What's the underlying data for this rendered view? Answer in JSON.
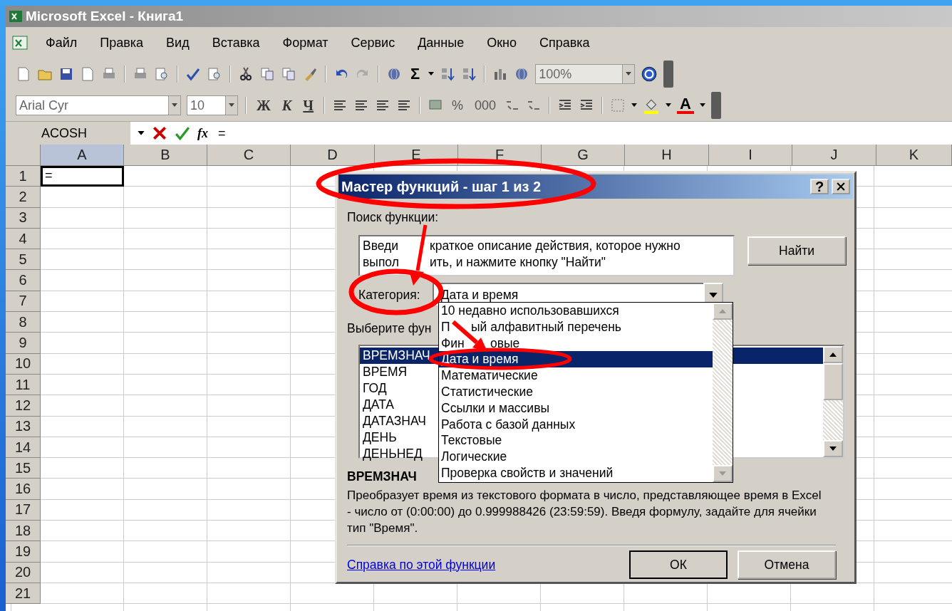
{
  "window": {
    "title": "Microsoft Excel - Книга1"
  },
  "menu": [
    "Файл",
    "Правка",
    "Вид",
    "Вставка",
    "Формат",
    "Сервис",
    "Данные",
    "Окно",
    "Справка"
  ],
  "standard_toolbar": {
    "sum": "Σ",
    "zoom": "100%"
  },
  "formatting_toolbar": {
    "font": "Arial Cyr",
    "size": "10",
    "styles": [
      "Ж",
      "К",
      "Ч"
    ],
    "percent": "%",
    "thousands": "000",
    "font_color": "A"
  },
  "formula_bar": {
    "name_box": "ACOSH",
    "fx": "fx",
    "value": "="
  },
  "sheet": {
    "columns": [
      "A",
      "B",
      "C",
      "D",
      "E",
      "F",
      "G",
      "H",
      "I",
      "J",
      "K"
    ],
    "rows": [
      "1",
      "2",
      "3",
      "4",
      "5",
      "6",
      "7",
      "8",
      "9",
      "10",
      "11",
      "12",
      "13",
      "14",
      "15",
      "16",
      "17",
      "18",
      "19",
      "20",
      "21"
    ],
    "active_cell": {
      "value": "=",
      "selected": true
    }
  },
  "dialog": {
    "title": "Мастер функций - шаг 1 из 2",
    "help": "?",
    "search_label": "Поиск функции:",
    "search_lines": [
      [
        "Введи",
        "краткое описание действия, которое нужно"
      ],
      [
        "выпол",
        "ить, и нажмите кнопку \"Найти\""
      ]
    ],
    "find_button": "Найти",
    "category_label": "Категория:",
    "category_value": "Дата и время",
    "select_label": "Выберите фун",
    "functions": [
      {
        "name": "ВРЕМЗНАЧ",
        "selected": true
      },
      {
        "name": "ВРЕМЯ",
        "selected": false
      },
      {
        "name": "ГОД",
        "selected": false
      },
      {
        "name": "ДАТА",
        "selected": false
      },
      {
        "name": "ДАТАЗНАЧ",
        "selected": false
      },
      {
        "name": "ДЕНЬ",
        "selected": false
      },
      {
        "name": "ДЕНЬНЕД",
        "selected": false
      }
    ],
    "category_options": [
      {
        "label": [
          "10 недавно использовавшихся"
        ],
        "selected": false
      },
      {
        "label": [
          "П",
          "ый алфавитный перечень"
        ],
        "selected": false
      },
      {
        "label": [
          "Фин",
          "овые"
        ],
        "selected": false
      },
      {
        "label": [
          "Дата и время"
        ],
        "selected": true
      },
      {
        "label": [
          "Математические"
        ],
        "selected": false
      },
      {
        "label": [
          "Статистические"
        ],
        "selected": false
      },
      {
        "label": [
          "Ссылки и массивы"
        ],
        "selected": false
      },
      {
        "label": [
          "Работа с базой данных"
        ],
        "selected": false
      },
      {
        "label": [
          "Текстовые"
        ],
        "selected": false
      },
      {
        "label": [
          "Логические"
        ],
        "selected": false
      },
      {
        "label": [
          "Проверка свойств и значений"
        ],
        "selected": false
      }
    ],
    "description_name": "ВРЕМЗНАЧ",
    "description": "Преобразует время из текстового формата в число, представляющее время в Excel - число от (0:00:00) до 0.999988426 (23:59:59). Введя формулу, задайте для ячейки тип \"Время\".",
    "help_link": "Справка по этой функции",
    "buttons": [
      "ОК",
      "Отмена"
    ]
  }
}
